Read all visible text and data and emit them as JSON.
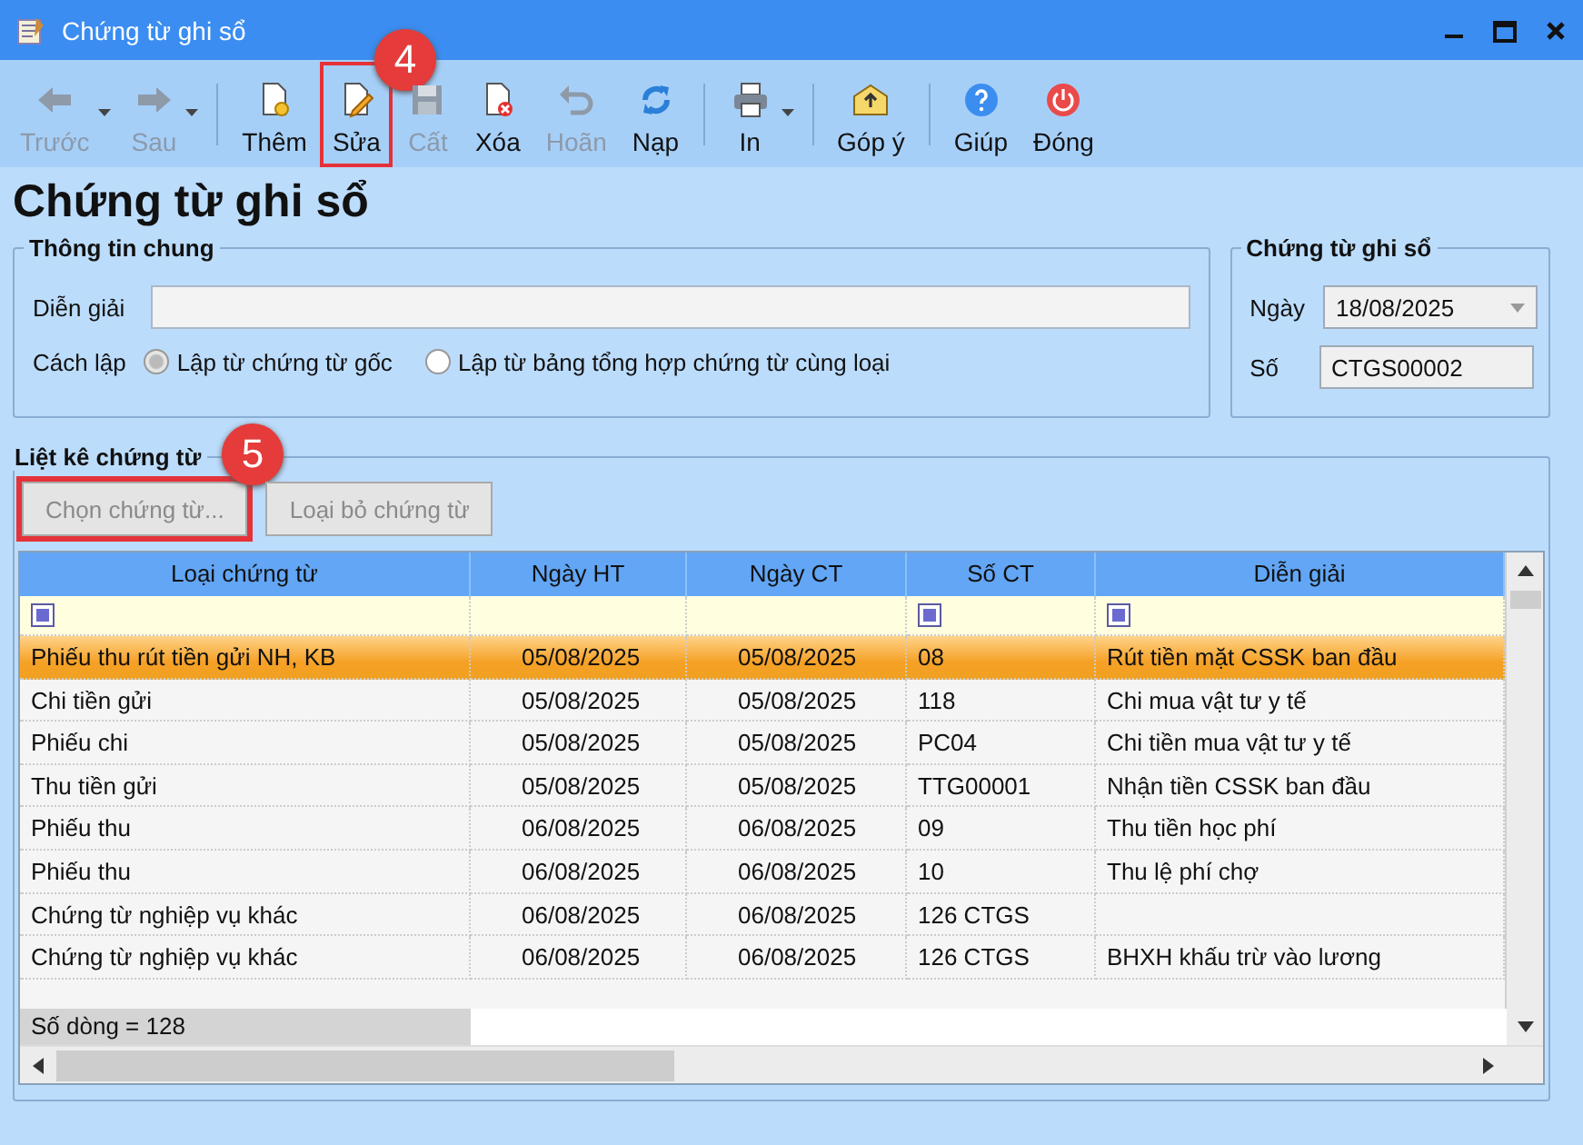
{
  "window": {
    "title": "Chứng từ ghi sổ"
  },
  "toolbar": {
    "groups": [
      [
        {
          "label": "Trước",
          "disabled": true,
          "dropdown": true
        },
        {
          "label": "Sau",
          "disabled": true,
          "dropdown": true
        }
      ],
      [
        {
          "label": "Thêm",
          "disabled": false,
          "dropdown": false
        },
        {
          "label": "Sửa",
          "disabled": false,
          "dropdown": false,
          "callout": "4"
        },
        {
          "label": "Cất",
          "disabled": true,
          "dropdown": false
        },
        {
          "label": "Xóa",
          "disabled": false,
          "dropdown": false
        },
        {
          "label": "Hoãn",
          "disabled": true,
          "dropdown": false
        },
        {
          "label": "Nạp",
          "disabled": false,
          "dropdown": false
        }
      ],
      [
        {
          "label": "In",
          "disabled": false,
          "dropdown": true
        }
      ],
      [
        {
          "label": "Góp ý",
          "disabled": false,
          "dropdown": false
        }
      ],
      [
        {
          "label": "Giúp",
          "disabled": false,
          "dropdown": false
        },
        {
          "label": "Đóng",
          "disabled": false,
          "dropdown": false
        }
      ]
    ]
  },
  "heading": "Chứng từ ghi sổ",
  "general": {
    "title": "Thông tin chung",
    "description_label": "Diễn giải",
    "method_label": "Cách lập",
    "methods": [
      {
        "label": "Lập từ chứng từ gốc",
        "selected": true
      },
      {
        "label": "Lập từ bảng tổng hợp chứng từ cùng loại",
        "selected": false
      }
    ]
  },
  "voucher": {
    "title": "Chứng từ ghi sổ",
    "date_label": "Ngày",
    "date": "18/08/2025",
    "number_label": "Số",
    "number": "CTGS00002"
  },
  "list": {
    "title": "Liệt kê chứng từ",
    "buttons": [
      {
        "label": "Chọn chứng từ...",
        "disabled": true,
        "callout": "5"
      },
      {
        "label": "Loại bỏ chứng từ",
        "disabled": true
      }
    ],
    "table": {
      "columns": [
        {
          "label": "Loại chứng từ",
          "filter": true
        },
        {
          "label": "Ngày HT",
          "filter": false
        },
        {
          "label": "Ngày CT",
          "filter": false
        },
        {
          "label": "Số CT",
          "filter": true
        },
        {
          "label": "Diễn giải",
          "filter": true
        }
      ],
      "rows": [
        {
          "selected": true,
          "cells": [
            "Phiếu thu rút tiền gửi NH, KB",
            "05/08/2025",
            "05/08/2025",
            "08",
            "Rút tiền mặt CSSK ban đầu"
          ]
        },
        {
          "selected": false,
          "cells": [
            "Chi tiền gửi",
            "05/08/2025",
            "05/08/2025",
            "118",
            "Chi mua vật tư y tế"
          ]
        },
        {
          "selected": false,
          "cells": [
            "Phiếu chi",
            "05/08/2025",
            "05/08/2025",
            "PC04",
            "Chi tiền mua vật tư y tế"
          ]
        },
        {
          "selected": false,
          "cells": [
            "Thu tiền gửi",
            "05/08/2025",
            "05/08/2025",
            "TTG00001",
            "Nhận tiền CSSK ban đầu"
          ]
        },
        {
          "selected": false,
          "cells": [
            "Phiếu thu",
            "06/08/2025",
            "06/08/2025",
            "09",
            "Thu tiền học phí"
          ]
        },
        {
          "selected": false,
          "cells": [
            "Phiếu thu",
            "06/08/2025",
            "06/08/2025",
            "10",
            "Thu lệ phí chợ"
          ]
        },
        {
          "selected": false,
          "cells": [
            "Chứng từ nghiệp vụ khác",
            "06/08/2025",
            "06/08/2025",
            "126 CTGS",
            ""
          ]
        },
        {
          "selected": false,
          "cells": [
            "Chứng từ nghiệp vụ khác",
            "06/08/2025",
            "06/08/2025",
            "126 CTGS",
            "BHXH khấu trừ vào lương"
          ]
        }
      ],
      "footer": "Số dòng = 128"
    }
  }
}
